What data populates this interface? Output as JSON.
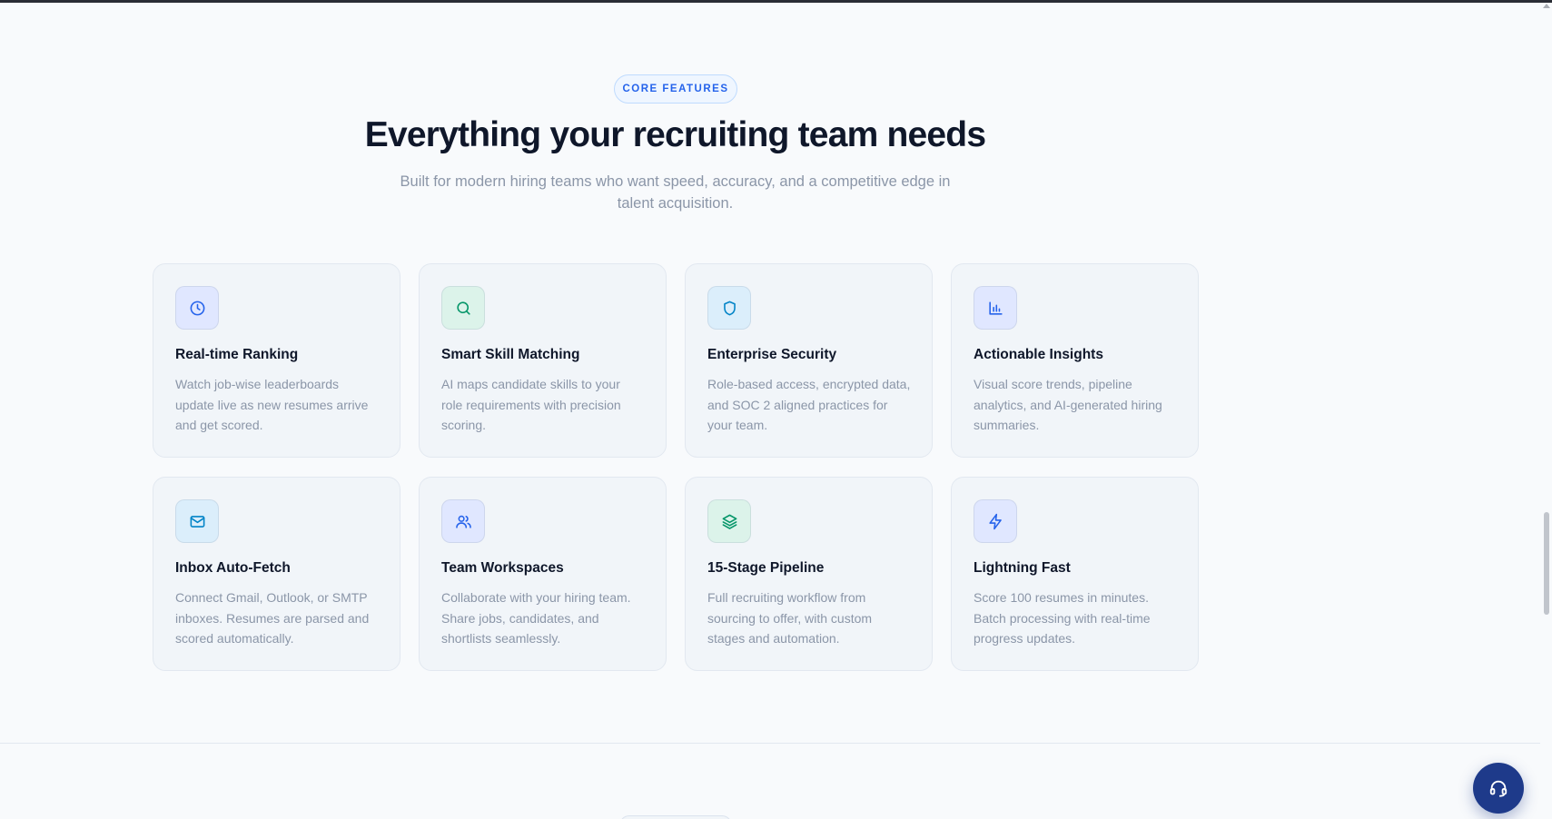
{
  "features_section": {
    "eyebrow": "CORE FEATURES",
    "title": "Everything your recruiting team needs",
    "subtitle": "Built for modern hiring teams who want speed, accuracy, and a competitive edge in talent acquisition."
  },
  "features": [
    {
      "icon": "clock-icon",
      "title": "Real-time Ranking",
      "description": "Watch job-wise leaderboards update live as new resumes arrive and get scored.",
      "icon_bg": "#e0e7ff",
      "icon_color": "#2563eb"
    },
    {
      "icon": "search-icon",
      "title": "Smart Skill Matching",
      "description": "AI maps candidate skills to your role requirements with precision scoring.",
      "icon_bg": "#dcf3ea",
      "icon_color": "#059669"
    },
    {
      "icon": "shield-icon",
      "title": "Enterprise Security",
      "description": "Role-based access, encrypted data, and SOC 2 aligned practices for your team.",
      "icon_bg": "#dbeefb",
      "icon_color": "#0284c7"
    },
    {
      "icon": "bar-chart-icon",
      "title": "Actionable Insights",
      "description": "Visual score trends, pipeline analytics, and AI-generated hiring summaries.",
      "icon_bg": "#e0e7ff",
      "icon_color": "#2563eb"
    },
    {
      "icon": "mail-icon",
      "title": "Inbox Auto-Fetch",
      "description": "Connect Gmail, Outlook, or SMTP inboxes. Resumes are parsed and scored automatically.",
      "icon_bg": "#dbeefb",
      "icon_color": "#0284c7"
    },
    {
      "icon": "users-icon",
      "title": "Team Workspaces",
      "description": "Collaborate with your hiring team. Share jobs, candidates, and shortlists seamlessly.",
      "icon_bg": "#e0e7ff",
      "icon_color": "#2563eb"
    },
    {
      "icon": "layers-icon",
      "title": "15-Stage Pipeline",
      "description": "Full recruiting workflow from sourcing to offer, with custom stages and automation.",
      "icon_bg": "#dcf3ea",
      "icon_color": "#059669"
    },
    {
      "icon": "zap-icon",
      "title": "Lightning Fast",
      "description": "Score 100 resumes in minutes. Batch processing with real-time progress updates.",
      "icon_bg": "#e0e7ff",
      "icon_color": "#2563eb"
    }
  ],
  "support_button": {
    "icon": "headset-icon",
    "color": "#1e3a8a"
  }
}
